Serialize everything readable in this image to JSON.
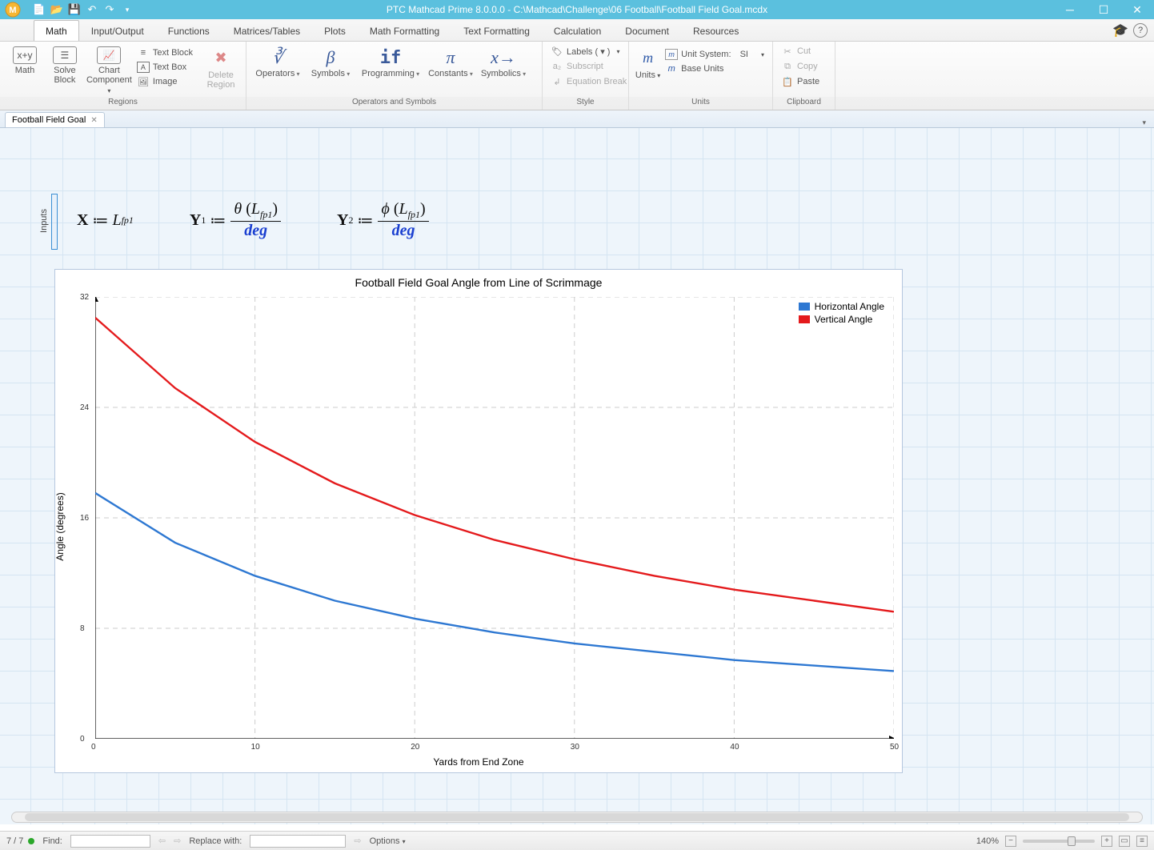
{
  "app": {
    "title": "PTC Mathcad Prime 8.0.0.0 - C:\\Mathcad\\Challenge\\06 Football\\Football Field Goal.mcdx"
  },
  "qat": {
    "new": "📄",
    "open": "📂",
    "save": "💾",
    "undo": "↶",
    "redo": "↷"
  },
  "tabs": {
    "active": "Math",
    "items": [
      "Math",
      "Input/Output",
      "Functions",
      "Matrices/Tables",
      "Plots",
      "Math Formatting",
      "Text Formatting",
      "Calculation",
      "Document",
      "Resources"
    ]
  },
  "ribbon": {
    "regions": {
      "label": "Regions",
      "math": "Math",
      "solve": "Solve\nBlock",
      "chart": "Chart\nComponent",
      "textblock": "Text Block",
      "textbox": "Text Box",
      "image": "Image",
      "delete": "Delete\nRegion"
    },
    "ops": {
      "label": "Operators and Symbols",
      "operators": "Operators",
      "symbols": "Symbols",
      "programming": "Programming",
      "constants": "Constants",
      "symbolics": "Symbolics"
    },
    "style": {
      "label": "Style",
      "labels": "Labels  ( ▾ )",
      "subscript": "Subscript",
      "eqbreak": "Equation Break"
    },
    "units": {
      "label": "Units",
      "units": "Units",
      "unitsystem": "Unit System:",
      "unitvalue": "SI",
      "baseunits": "Base Units"
    },
    "clipboard": {
      "label": "Clipboard",
      "cut": "Cut",
      "copy": "Copy",
      "paste": "Paste"
    }
  },
  "doctab": {
    "name": "Football Field Goal"
  },
  "inputs_label": "Inputs",
  "equations": {
    "x_lhs": "X",
    "x_rhs": "L",
    "x_sub": "fp1",
    "y1_lhs": "Y",
    "y1_sub": "1",
    "y1_num_fn": "θ",
    "y1_num_arg": "L",
    "y1_num_argsub": "fp1",
    "deg": "deg",
    "y2_lhs": "Y",
    "y2_sub": "2",
    "y2_num_fn": "ϕ",
    "y2_num_arg": "L",
    "y2_num_argsub": "fp1"
  },
  "chart_data": {
    "type": "line",
    "title": "Football Field Goal Angle from Line of Scrimmage",
    "xlabel": "Yards from End Zone",
    "ylabel": "Angle (degrees)",
    "xlim": [
      0,
      50
    ],
    "ylim": [
      0,
      32
    ],
    "xticks": [
      0,
      10,
      20,
      30,
      40,
      50
    ],
    "yticks": [
      0,
      8,
      16,
      24,
      32
    ],
    "legend_position": "top-right",
    "series": [
      {
        "name": "Horizontal Angle",
        "color": "#2e78d2",
        "x": [
          0,
          5,
          10,
          15,
          20,
          25,
          30,
          35,
          40,
          45,
          50
        ],
        "y": [
          17.8,
          14.2,
          11.8,
          10.0,
          8.7,
          7.7,
          6.9,
          6.3,
          5.7,
          5.3,
          4.9
        ]
      },
      {
        "name": "Vertical Angle",
        "color": "#e41a1c",
        "x": [
          0,
          5,
          10,
          15,
          20,
          25,
          30,
          35,
          40,
          45,
          50
        ],
        "y": [
          30.5,
          25.4,
          21.5,
          18.5,
          16.2,
          14.4,
          13.0,
          11.8,
          10.8,
          10.0,
          9.2
        ]
      }
    ]
  },
  "status": {
    "page": "7 / 7",
    "find_label": "Find:",
    "find_value": "",
    "replace_label": "Replace with:",
    "replace_value": "",
    "options": "Options",
    "zoom": "140%"
  }
}
